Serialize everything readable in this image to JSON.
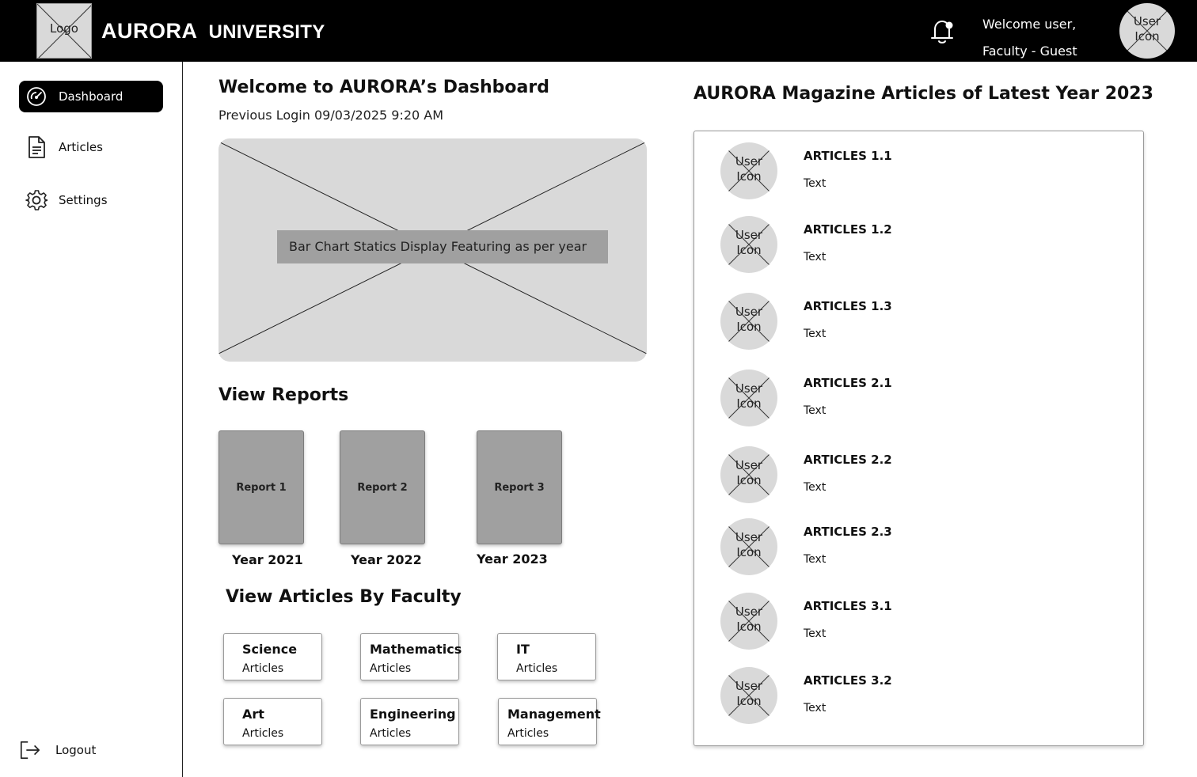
{
  "header": {
    "logo_text": "Logo",
    "brand_primary": "AURORA",
    "brand_secondary": "UNIVERSITY",
    "welcome_line1": "Welcome user,",
    "welcome_line2": "Faculty - Guest",
    "user_icon_line1": "User",
    "user_icon_line2": "Icon",
    "icons": {
      "bell": "bell-icon"
    }
  },
  "sidebar": {
    "items": [
      {
        "label": "Dashboard",
        "icon": "dashboard-gauge-icon",
        "active": true
      },
      {
        "label": "Articles",
        "icon": "document-icon",
        "active": false
      },
      {
        "label": "Settings",
        "icon": "gear-icon",
        "active": false
      }
    ],
    "logout_label": "Logout",
    "logout_icon": "logout-icon"
  },
  "main": {
    "title": "Welcome to AURORA’s Dashboard",
    "previous_login": "Previous Login 09/03/2025 9:20 AM",
    "chart_placeholder_caption": "Bar Chart Statics Display Featuring as per year",
    "reports_title": "View Reports",
    "reports": [
      {
        "label": "Report 1",
        "year": "Year 2021"
      },
      {
        "label": "Report 2",
        "year": "Year 2022"
      },
      {
        "label": "Report 3",
        "year": "Year 2023"
      }
    ],
    "faculty_title": "View Articles By Faculty",
    "faculties": [
      {
        "name": "Science",
        "sub": "Articles"
      },
      {
        "name": "Mathematics",
        "sub": "Articles"
      },
      {
        "name": "IT",
        "sub": "Articles"
      },
      {
        "name": "Art",
        "sub": "Articles"
      },
      {
        "name": "Engineering",
        "sub": "Articles"
      },
      {
        "name": "Management",
        "sub": "Articles"
      }
    ]
  },
  "articles": {
    "title": "AURORA Magazine Articles of Latest Year 2023",
    "avatar_line1": "User",
    "avatar_line2": "Icon",
    "items": [
      {
        "title": "ARTICLES 1.1",
        "text": "Text"
      },
      {
        "title": "ARTICLES 1.2",
        "text": "Text"
      },
      {
        "title": "ARTICLES 1.3",
        "text": "Text"
      },
      {
        "title": "ARTICLES 2.1",
        "text": "Text"
      },
      {
        "title": "ARTICLES 2.2",
        "text": "Text"
      },
      {
        "title": "ARTICLES 2.3",
        "text": "Text"
      },
      {
        "title": "ARTICLES 3.1",
        "text": "Text"
      },
      {
        "title": "ARTICLES 3.2",
        "text": "Text"
      }
    ]
  },
  "colors": {
    "header_bg": "#000000",
    "placeholder_gray": "#d9d9d9",
    "card_gray": "#a0a0a0",
    "active_nav_bg": "#000000"
  }
}
